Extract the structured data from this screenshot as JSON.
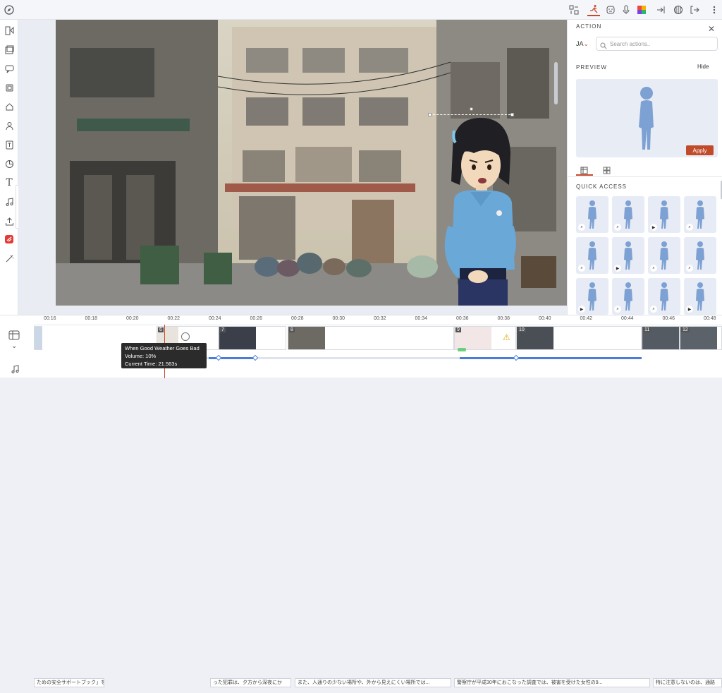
{
  "icons": {
    "top_left": "compass-icon",
    "top_right": [
      "layout-icon",
      "action-run-icon",
      "face-expression-icon",
      "microphone-icon",
      "color-palette-icon",
      "enter-icon",
      "camera-aperture-icon",
      "exit-icon",
      "more-vertical-icon"
    ],
    "left_sidebar": [
      "shapes-icon",
      "scene-template-icon",
      "chat-bubble-icon",
      "frame-icon",
      "prop-icon",
      "character-icon",
      "text-box-icon",
      "chart-icon",
      "text-icon",
      "music-icon",
      "upload-icon",
      "brand-icon",
      "effect-icon"
    ]
  },
  "action_panel": {
    "title": "ACTION",
    "language": "JA",
    "search_placeholder": "Search actions..",
    "preview_title": "PREVIEW",
    "hide_label": "Hide",
    "apply_label": "Apply",
    "quick_access_title": "QUICK ACCESS",
    "tiles": [
      {
        "badge": "zoom"
      },
      {
        "badge": "zoom"
      },
      {
        "badge": "play"
      },
      {
        "badge": "zoom"
      },
      {
        "badge": "zoom"
      },
      {
        "badge": "play"
      },
      {
        "badge": "zoom"
      },
      {
        "badge": "zoom"
      },
      {
        "badge": "play"
      },
      {
        "badge": "zoom"
      },
      {
        "badge": "zoom"
      },
      {
        "badge": "play"
      }
    ]
  },
  "timeline": {
    "ticks": [
      "00:16",
      "00:18",
      "00:20",
      "00:22",
      "00:24",
      "00:26",
      "00:28",
      "00:30",
      "00:32",
      "00:34",
      "00:36",
      "00:38",
      "00:40",
      "00:42",
      "00:44",
      "00:46",
      "00:48"
    ],
    "scenes": [
      "6",
      "7",
      "8",
      "9",
      "10",
      "11",
      "12"
    ],
    "tooltip": {
      "line1": "When Good Weather Goes Bad",
      "line2": "Volume: 10%",
      "line3": "Current Time: 21.563s"
    },
    "audio_clips": [
      "ための安全サポートブック」を...",
      "った犯罪は、夕方から深夜にか",
      "また、人通りの少ない場所や、外から見えにくい場所では...",
      "警察庁が平成30年におこなった調査では、被害を受けた女性の9...",
      "特に注意しないのは、通路"
    ]
  }
}
